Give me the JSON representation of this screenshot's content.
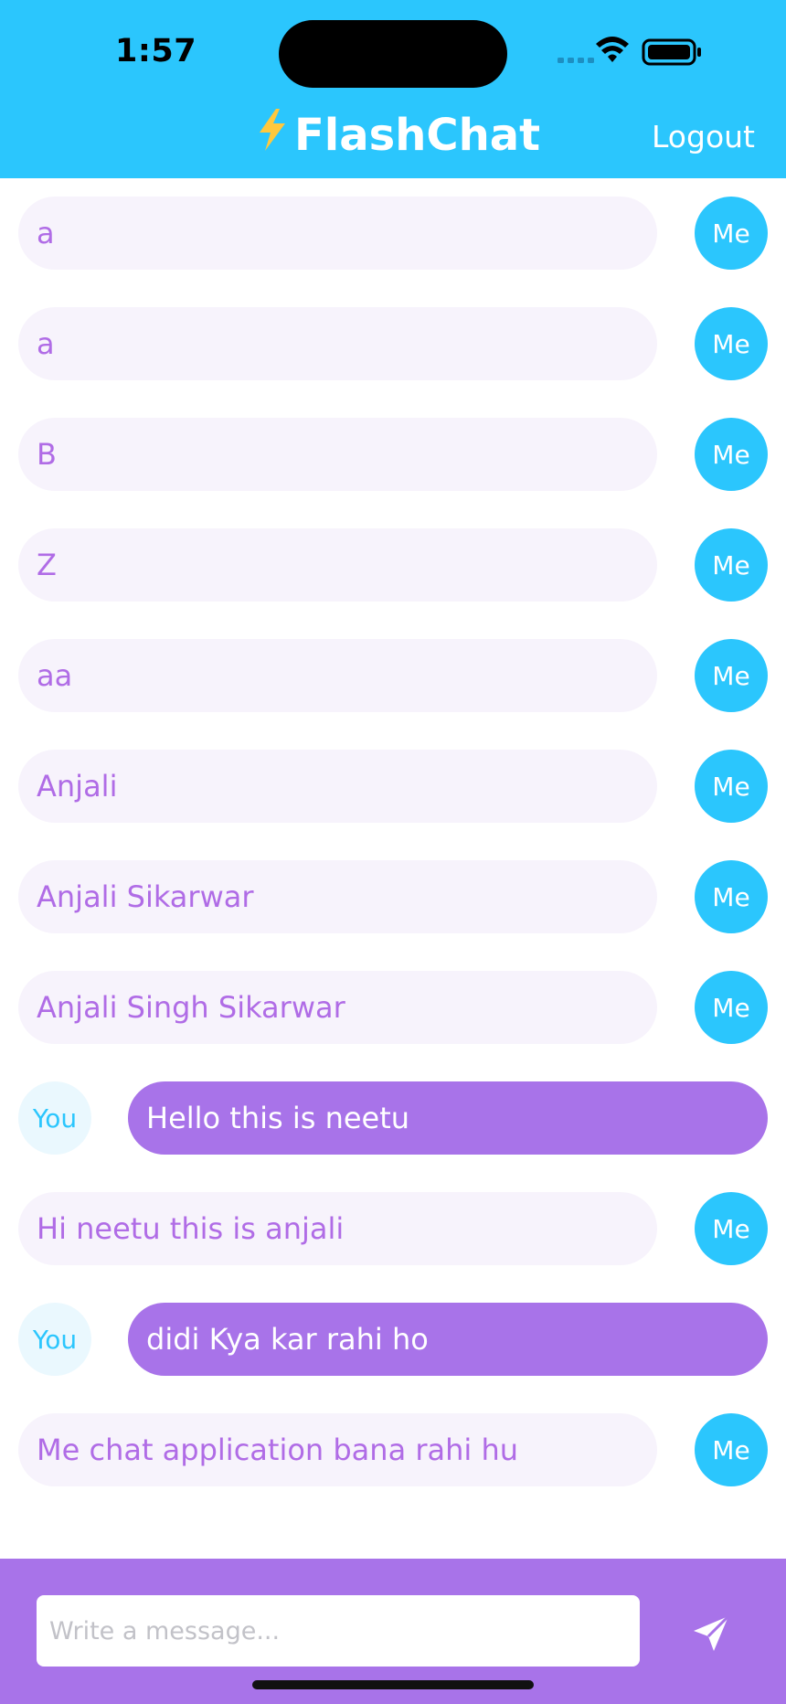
{
  "status_bar": {
    "time": "1:57"
  },
  "header": {
    "bolt_icon": "⚡",
    "title": "FlashChat",
    "logout_label": "Logout"
  },
  "colors": {
    "header": "#2bc6fd",
    "me_bubble": "#f7f3fc",
    "me_text": "#b06ce6",
    "you_bubble": "#a873e9",
    "avatar_me": "#2bc6fd",
    "avatar_you_bg": "#eaf8fe",
    "composer": "#a873e9"
  },
  "messages": [
    {
      "sender": "me",
      "avatar": "Me",
      "text": "a"
    },
    {
      "sender": "me",
      "avatar": "Me",
      "text": "a"
    },
    {
      "sender": "me",
      "avatar": "Me",
      "text": "B"
    },
    {
      "sender": "me",
      "avatar": "Me",
      "text": "Z"
    },
    {
      "sender": "me",
      "avatar": "Me",
      "text": "aa"
    },
    {
      "sender": "me",
      "avatar": "Me",
      "text": "Anjali"
    },
    {
      "sender": "me",
      "avatar": "Me",
      "text": "Anjali Sikarwar"
    },
    {
      "sender": "me",
      "avatar": "Me",
      "text": "Anjali Singh Sikarwar"
    },
    {
      "sender": "you",
      "avatar": "You",
      "text": "Hello this is neetu"
    },
    {
      "sender": "me",
      "avatar": "Me",
      "text": "Hi neetu this is anjali"
    },
    {
      "sender": "you",
      "avatar": "You",
      "text": "didi Kya kar rahi ho"
    },
    {
      "sender": "me",
      "avatar": "Me",
      "text": "Me chat application bana rahi hu"
    }
  ],
  "composer": {
    "value": "",
    "placeholder": "Write a message...",
    "send_icon": "paper-plane-icon"
  }
}
